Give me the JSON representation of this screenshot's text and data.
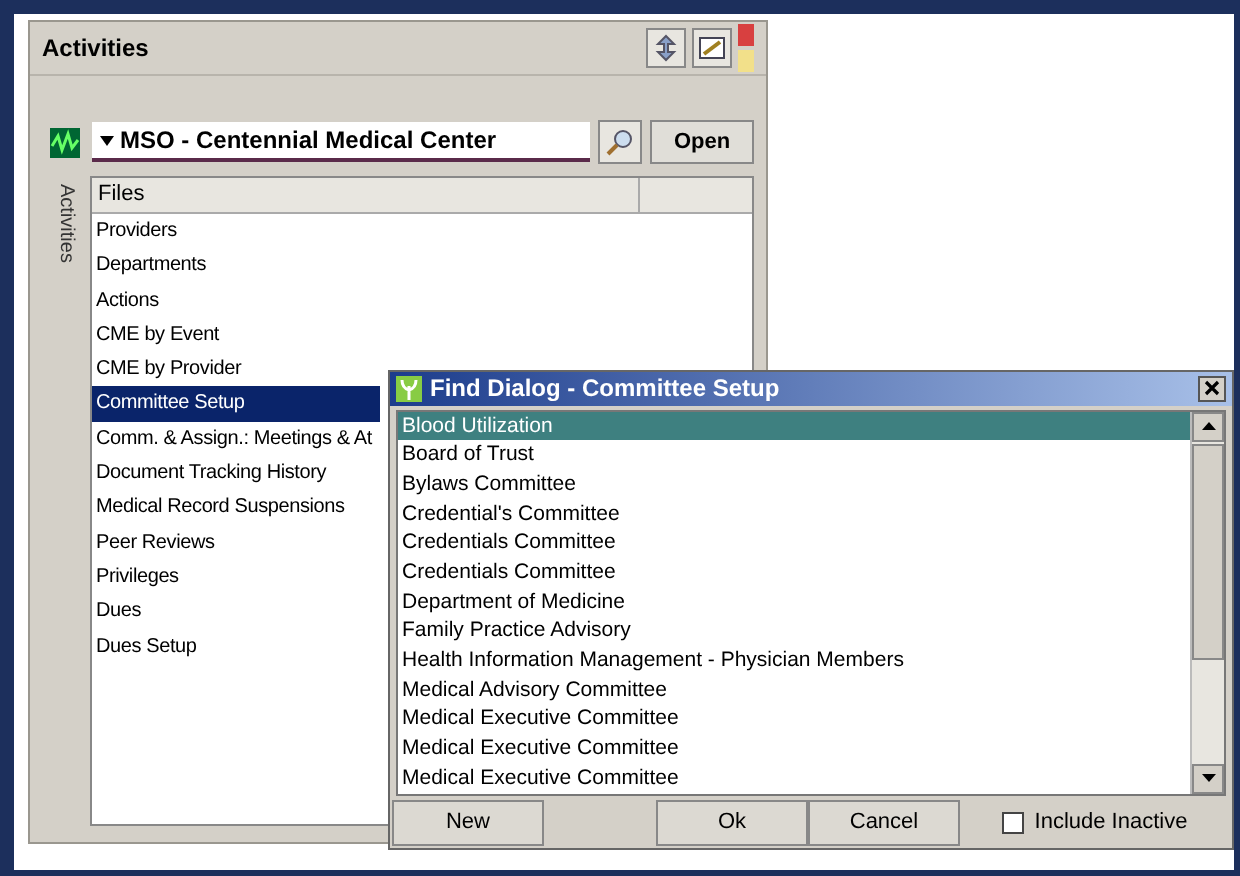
{
  "panel": {
    "title": "Activities",
    "side_tab": "Activities",
    "organization": "MSO - Centennial Medical Center",
    "open_button": "Open",
    "files": {
      "columns": [
        "Files"
      ],
      "items": [
        {
          "label": "Providers",
          "selected": false
        },
        {
          "label": "Departments",
          "selected": false
        },
        {
          "label": "Actions",
          "selected": false
        },
        {
          "label": "CME by Event",
          "selected": false
        },
        {
          "label": "CME by Provider",
          "selected": false
        },
        {
          "label": "Committee Setup",
          "selected": true
        },
        {
          "label": "Comm. & Assign.: Meetings & At",
          "selected": false
        },
        {
          "label": "Document Tracking History",
          "selected": false
        },
        {
          "label": "Medical Record Suspensions",
          "selected": false
        },
        {
          "label": "Peer Reviews",
          "selected": false
        },
        {
          "label": "Privileges",
          "selected": false
        },
        {
          "label": "Dues",
          "selected": false
        },
        {
          "label": "Dues Setup",
          "selected": false
        }
      ]
    }
  },
  "dialog": {
    "title": "Find Dialog - Committee Setup",
    "items": [
      {
        "label": "Blood Utilization",
        "selected": true
      },
      {
        "label": "Board of Trust",
        "selected": false
      },
      {
        "label": "Bylaws Committee",
        "selected": false
      },
      {
        "label": "Credential's Committee",
        "selected": false
      },
      {
        "label": "Credentials Committee",
        "selected": false
      },
      {
        "label": "Credentials Committee",
        "selected": false
      },
      {
        "label": "Department of Medicine",
        "selected": false
      },
      {
        "label": "Family Practice Advisory",
        "selected": false
      },
      {
        "label": "Health Information Management - Physician Members",
        "selected": false
      },
      {
        "label": "Medical Advisory Committee",
        "selected": false
      },
      {
        "label": "Medical Executive Committee",
        "selected": false
      },
      {
        "label": "Medical Executive Committee",
        "selected": false
      },
      {
        "label": "Medical Executive Committee",
        "selected": false
      }
    ],
    "buttons": [
      "New",
      "Ok",
      "Cancel"
    ],
    "include_inactive": {
      "label": "Include Inactive",
      "checked": false
    }
  }
}
